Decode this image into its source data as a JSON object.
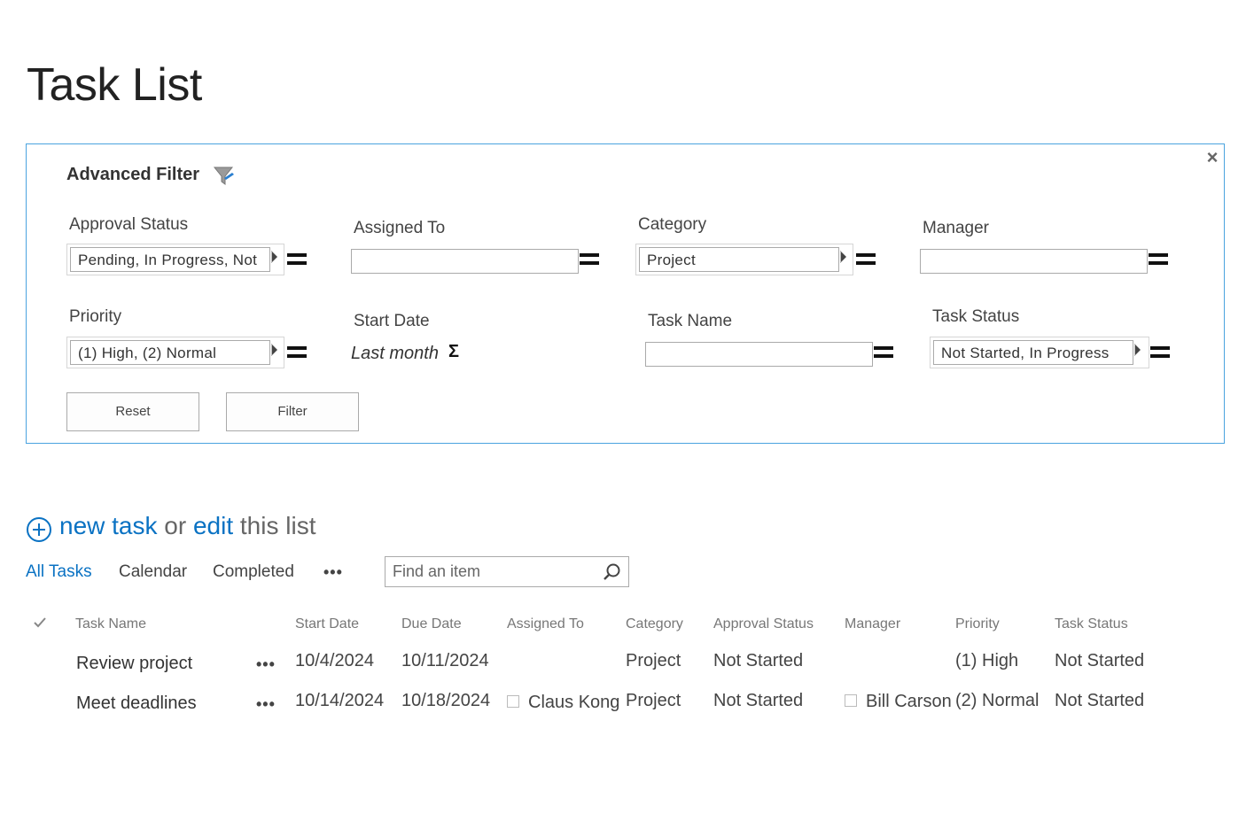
{
  "page": {
    "title": "Task List"
  },
  "advanced_filter": {
    "heading": "Advanced Filter",
    "close_icon": "close-icon",
    "fields": {
      "approval_status": {
        "label": "Approval Status",
        "value": "Pending, In Progress, Not"
      },
      "assigned_to": {
        "label": "Assigned To",
        "value": ""
      },
      "category": {
        "label": "Category",
        "value": "Project"
      },
      "manager": {
        "label": "Manager",
        "value": ""
      },
      "priority": {
        "label": "Priority",
        "value": "(1) High, (2) Normal"
      },
      "start_date": {
        "label": "Start Date",
        "value": "Last month"
      },
      "task_name": {
        "label": "Task Name",
        "value": ""
      },
      "task_status": {
        "label": "Task Status",
        "value": "Not Started, In Progress"
      }
    },
    "buttons": {
      "reset": "Reset",
      "filter": "Filter"
    }
  },
  "list_toolbar": {
    "new_task": "new task",
    "or": "or",
    "edit": "edit",
    "this_list": "this list",
    "views": [
      "All Tasks",
      "Calendar",
      "Completed"
    ],
    "more": "•••",
    "search_placeholder": "Find an item"
  },
  "table": {
    "columns": [
      "Task Name",
      "Start Date",
      "Due Date",
      "Assigned To",
      "Category",
      "Approval Status",
      "Manager",
      "Priority",
      "Task Status"
    ],
    "rows": [
      {
        "task_name": "Review project",
        "start_date": "10/4/2024",
        "due_date": "10/11/2024",
        "assigned_to": "",
        "category": "Project",
        "approval_status": "Not Started",
        "manager": "",
        "priority": "(1) High",
        "task_status": "Not Started"
      },
      {
        "task_name": "Meet deadlines",
        "start_date": "10/14/2024",
        "due_date": "10/18/2024",
        "assigned_to": "Claus Kong",
        "category": "Project",
        "approval_status": "Not Started",
        "manager": "Bill Carson",
        "priority": "(2) Normal",
        "task_status": "Not Started"
      }
    ],
    "row_menu": "•••"
  },
  "colors": {
    "accent": "#0a72c3",
    "panel_border": "#4aa3df"
  }
}
